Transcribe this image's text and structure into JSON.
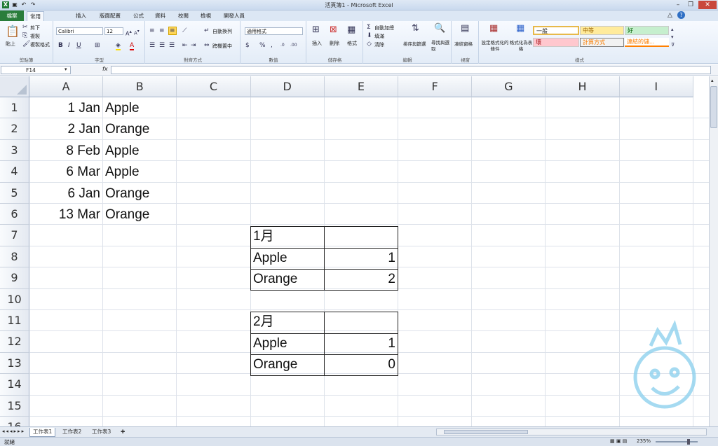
{
  "window": {
    "title": "活頁簿1 - Microsoft Excel"
  },
  "tabs": [
    "檔案",
    "常用",
    "插入",
    "版面配置",
    "公式",
    "資料",
    "校閱",
    "檢視",
    "開發人員"
  ],
  "ribbon": {
    "clipboard": {
      "paste": "貼上",
      "cut": "剪下",
      "copy": "複製",
      "format_painter": "複製格式",
      "label": "剪貼簿"
    },
    "font": {
      "name": "Calibri",
      "size": "12",
      "label": "字型"
    },
    "alignment": {
      "wrap": "自動換列",
      "merge": "跨欄置中",
      "label": "對齊方式"
    },
    "number": {
      "format": "通用格式",
      "label": "數值"
    },
    "cells": {
      "insert": "插入",
      "delete": "刪除",
      "format": "格式",
      "label": "儲存格"
    },
    "editing": {
      "autosum": "自動加總",
      "fill": "填滿",
      "clear": "清除",
      "sort": "排序與篩選",
      "find": "尋找與選取",
      "label": "編輯"
    },
    "window": {
      "freeze": "凍結窗格",
      "label": "視窗"
    },
    "styles": {
      "cond": "設定格式化的條件",
      "table": "格式化為表格",
      "label": "樣式",
      "normal": "一般",
      "neutral": "中等",
      "good": "好",
      "bad": "壞",
      "calc": "計算方式",
      "linked": "連結的儲..."
    }
  },
  "formula_bar": {
    "name_box": "F14",
    "fx": "fx",
    "value": ""
  },
  "columns": [
    "A",
    "B",
    "C",
    "D",
    "E",
    "F",
    "G",
    "H",
    "I"
  ],
  "rows": [
    "1",
    "2",
    "3",
    "4",
    "5",
    "6",
    "7",
    "8",
    "9",
    "10",
    "11",
    "12",
    "13",
    "14",
    "15",
    "16"
  ],
  "cells": {
    "A1": "1 Jan",
    "B1": "Apple",
    "A2": "2 Jan",
    "B2": "Orange",
    "A3": "8 Feb",
    "B3": "Apple",
    "A4": "6 Mar",
    "B4": "Apple",
    "A5": "6 Jan",
    "B5": "Orange",
    "A6": "13 Mar",
    "B6": "Orange",
    "D7": "1月",
    "D8": "Apple",
    "E8": "1",
    "D9": "Orange",
    "E9": "2",
    "D11": "2月",
    "D12": "Apple",
    "E12": "1",
    "D13": "Orange",
    "E13": "0"
  },
  "sheets": [
    "工作表1",
    "工作表2",
    "工作表3"
  ],
  "status": {
    "ready": "就緒",
    "zoom": "235%"
  }
}
